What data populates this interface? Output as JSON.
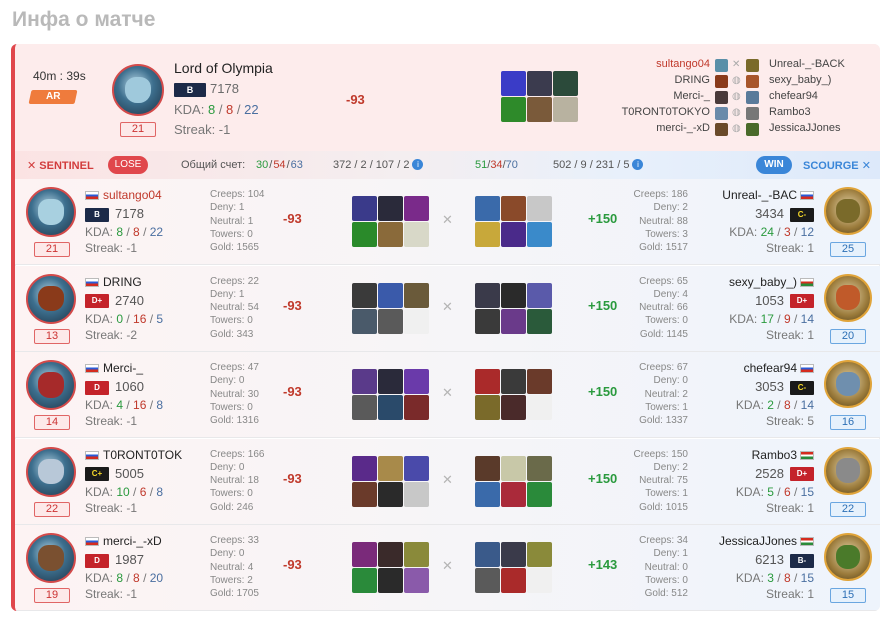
{
  "page": {
    "title": "Инфа о матче"
  },
  "summary": {
    "duration": "40m : 39s",
    "mode": "AR",
    "player": {
      "name": "Lord of Olympia",
      "rank": "B",
      "rating": "7178",
      "kda_label": "KDA:",
      "kills": "8",
      "deaths": "8",
      "assists": "22",
      "streak": "Streak: -1",
      "level": "21",
      "diff": "-93"
    },
    "roster_left": [
      "sultango04",
      "DRING",
      "Merci-_",
      "T0RONT0TOKYO",
      "merci-_-xD"
    ],
    "roster_right": [
      "Unreal-_-BACK",
      "sexy_baby_)",
      "chefear94",
      "Rambo3",
      "JessicaJJones"
    ]
  },
  "teams": {
    "sentinel": {
      "name": "SENTINEL",
      "result": "LOSE"
    },
    "scourge": {
      "name": "SCOURGE",
      "result": "WIN"
    },
    "score_label": "Общий счет:",
    "left_kda": [
      "30",
      "54",
      "63"
    ],
    "left_totals": "372 / 2 / 107 / 2",
    "right_kda": [
      "51",
      "34",
      "70"
    ],
    "right_totals": "502 / 9 / 231 / 5",
    "info": "i"
  },
  "rows": [
    {
      "left": {
        "name": "sultango04",
        "rank": "B",
        "rank_class": "b",
        "rating": "7178",
        "k": "8",
        "d": "8",
        "a": "22",
        "streak": "Streak: -1",
        "level": "21",
        "creeps": "Creeps: 104",
        "deny": "Deny: 1",
        "neutral": "Neutral: 1",
        "towers": "Towers: 0",
        "gold": "Gold: 1565",
        "diff": "-93"
      },
      "right": {
        "name": "Unreal-_-BAC",
        "rank": "C-",
        "rank_class": "c",
        "rating": "3434",
        "k": "24",
        "d": "3",
        "a": "12",
        "streak": "Streak: 1",
        "level": "25",
        "creeps": "Creeps: 186",
        "deny": "Deny: 2",
        "neutral": "Neutral: 88",
        "towers": "Towers: 3",
        "gold": "Gold: 1517",
        "diff": "+150"
      }
    },
    {
      "left": {
        "name": "DRING",
        "rank": "D+",
        "rank_class": "d",
        "rating": "2740",
        "k": "0",
        "d": "16",
        "a": "5",
        "streak": "Streak: -2",
        "level": "13",
        "creeps": "Creeps: 22",
        "deny": "Deny: 1",
        "neutral": "Neutral: 54",
        "towers": "Towers: 0",
        "gold": "Gold: 343",
        "diff": "-93"
      },
      "right": {
        "name": "sexy_baby_)",
        "rank": "D+",
        "rank_class": "d",
        "rating": "1053",
        "k": "17",
        "d": "9",
        "a": "14",
        "streak": "Streak: 1",
        "level": "20",
        "creeps": "Creeps: 65",
        "deny": "Deny: 4",
        "neutral": "Neutral: 66",
        "towers": "Towers: 0",
        "gold": "Gold: 1145",
        "diff": "+150"
      }
    },
    {
      "left": {
        "name": "Merci-_",
        "rank": "D",
        "rank_class": "d",
        "rating": "1060",
        "k": "4",
        "d": "16",
        "a": "8",
        "streak": "Streak: -1",
        "level": "14",
        "creeps": "Creeps: 47",
        "deny": "Deny: 0",
        "neutral": "Neutral: 30",
        "towers": "Towers: 0",
        "gold": "Gold: 1316",
        "diff": "-93"
      },
      "right": {
        "name": "chefear94",
        "rank": "C-",
        "rank_class": "c",
        "rating": "3053",
        "k": "2",
        "d": "8",
        "a": "14",
        "streak": "Streak: 5",
        "level": "16",
        "creeps": "Creeps: 67",
        "deny": "Deny: 0",
        "neutral": "Neutral: 2",
        "towers": "Towers: 1",
        "gold": "Gold: 1337",
        "diff": "+150"
      }
    },
    {
      "left": {
        "name": "T0RONT0TOK",
        "rank": "C+",
        "rank_class": "c",
        "rating": "5005",
        "k": "10",
        "d": "6",
        "a": "8",
        "streak": "Streak: -1",
        "level": "22",
        "creeps": "Creeps: 166",
        "deny": "Deny: 0",
        "neutral": "Neutral: 18",
        "towers": "Towers: 0",
        "gold": "Gold: 246",
        "diff": "-93"
      },
      "right": {
        "name": "Rambo3",
        "rank": "D+",
        "rank_class": "d",
        "rating": "2528",
        "k": "5",
        "d": "6",
        "a": "15",
        "streak": "Streak: 1",
        "level": "22",
        "creeps": "Creeps: 150",
        "deny": "Deny: 2",
        "neutral": "Neutral: 75",
        "towers": "Towers: 1",
        "gold": "Gold: 1015",
        "diff": "+150"
      }
    },
    {
      "left": {
        "name": "merci-_-xD",
        "rank": "D",
        "rank_class": "d",
        "rating": "1987",
        "k": "8",
        "d": "8",
        "a": "20",
        "streak": "Streak: -1",
        "level": "19",
        "creeps": "Creeps: 33",
        "deny": "Deny: 0",
        "neutral": "Neutral: 4",
        "towers": "Towers: 2",
        "gold": "Gold: 1705",
        "diff": "-93"
      },
      "right": {
        "name": "JessicaJJones",
        "rank": "B-",
        "rank_class": "b",
        "rating": "6213",
        "k": "3",
        "d": "8",
        "a": "15",
        "streak": "Streak: 1",
        "level": "15",
        "creeps": "Creeps: 34",
        "deny": "Deny: 1",
        "neutral": "Neutral: 0",
        "towers": "Towers: 0",
        "gold": "Gold: 512",
        "diff": "+143"
      }
    }
  ],
  "colors": {
    "lose": "#e0474c",
    "win": "#3a86d8",
    "positive": "#2a9a3e",
    "negative": "#c0392b"
  }
}
